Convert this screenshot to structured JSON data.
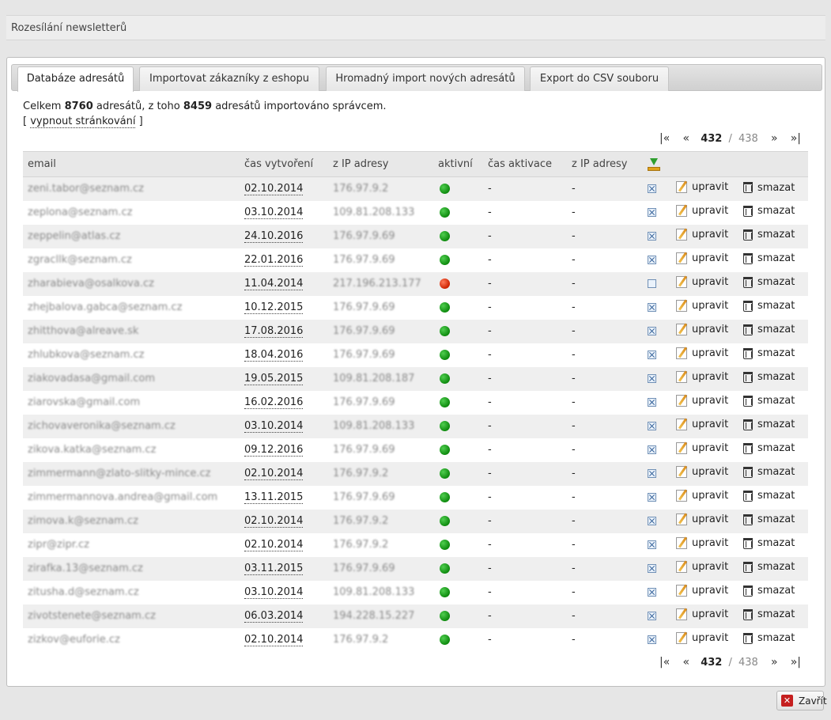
{
  "header": {
    "title": "Rozesílání newsletterů"
  },
  "tabs": [
    {
      "label": "Databáze adresátů",
      "active": true
    },
    {
      "label": "Importovat zákazníky z eshopu",
      "active": false
    },
    {
      "label": "Hromadný import nových adresátů",
      "active": false
    },
    {
      "label": "Export do CSV souboru",
      "active": false
    }
  ],
  "summary": {
    "prefix": "Celkem",
    "total": "8760",
    "middle": "adresátů, z toho",
    "imported": "8459",
    "suffix": "adresátů importováno správcem.",
    "paging_open": "[",
    "paging_link": "vypnout stránkování",
    "paging_close": "]"
  },
  "pager": {
    "first": "|«",
    "prev": "«",
    "current": "432",
    "separator": "/",
    "total": "438",
    "next": "»",
    "last": "»|"
  },
  "columns": {
    "email": "email",
    "created": "čas vytvoření",
    "ip": "z IP adresy",
    "active": "aktivní",
    "activated": "čas aktivace",
    "activated_ip": "z IP adresy",
    "export_icon": "export-icon"
  },
  "actions": {
    "edit": "upravit",
    "delete": "smazat"
  },
  "rows": [
    {
      "email": "zeni.tabor@seznam.cz",
      "created": "02.10.2014",
      "ip": "176.97.9.2",
      "active": true,
      "activated": "-",
      "activated_ip": "-",
      "checked": true
    },
    {
      "email": "zeplona@seznam.cz",
      "created": "03.10.2014",
      "ip": "109.81.208.133",
      "active": true,
      "activated": "-",
      "activated_ip": "-",
      "checked": true
    },
    {
      "email": "zeppelin@atlas.cz",
      "created": "24.10.2016",
      "ip": "176.97.9.69",
      "active": true,
      "activated": "-",
      "activated_ip": "-",
      "checked": true
    },
    {
      "email": "zgracllk@seznam.cz",
      "created": "22.01.2016",
      "ip": "176.97.9.69",
      "active": true,
      "activated": "-",
      "activated_ip": "-",
      "checked": true
    },
    {
      "email": "zharabieva@osalkova.cz",
      "created": "11.04.2014",
      "ip": "217.196.213.177",
      "active": false,
      "activated": "-",
      "activated_ip": "-",
      "checked": false
    },
    {
      "email": "zhejbalova.gabca@seznam.cz",
      "created": "10.12.2015",
      "ip": "176.97.9.69",
      "active": true,
      "activated": "-",
      "activated_ip": "-",
      "checked": true
    },
    {
      "email": "zhitthova@alreave.sk",
      "created": "17.08.2016",
      "ip": "176.97.9.69",
      "active": true,
      "activated": "-",
      "activated_ip": "-",
      "checked": true
    },
    {
      "email": "zhlubkova@seznam.cz",
      "created": "18.04.2016",
      "ip": "176.97.9.69",
      "active": true,
      "activated": "-",
      "activated_ip": "-",
      "checked": true
    },
    {
      "email": "ziakovadasa@gmail.com",
      "created": "19.05.2015",
      "ip": "109.81.208.187",
      "active": true,
      "activated": "-",
      "activated_ip": "-",
      "checked": true
    },
    {
      "email": "ziarovska@gmail.com",
      "created": "16.02.2016",
      "ip": "176.97.9.69",
      "active": true,
      "activated": "-",
      "activated_ip": "-",
      "checked": true
    },
    {
      "email": "zichovaveronika@seznam.cz",
      "created": "03.10.2014",
      "ip": "109.81.208.133",
      "active": true,
      "activated": "-",
      "activated_ip": "-",
      "checked": true
    },
    {
      "email": "zikova.katka@seznam.cz",
      "created": "09.12.2016",
      "ip": "176.97.9.69",
      "active": true,
      "activated": "-",
      "activated_ip": "-",
      "checked": true
    },
    {
      "email": "zimmermann@zlato-slitky-mince.cz",
      "created": "02.10.2014",
      "ip": "176.97.9.2",
      "active": true,
      "activated": "-",
      "activated_ip": "-",
      "checked": true
    },
    {
      "email": "zimmermannova.andrea@gmail.com",
      "created": "13.11.2015",
      "ip": "176.97.9.69",
      "active": true,
      "activated": "-",
      "activated_ip": "-",
      "checked": true
    },
    {
      "email": "zimova.k@seznam.cz",
      "created": "02.10.2014",
      "ip": "176.97.9.2",
      "active": true,
      "activated": "-",
      "activated_ip": "-",
      "checked": true
    },
    {
      "email": "zipr@zipr.cz",
      "created": "02.10.2014",
      "ip": "176.97.9.2",
      "active": true,
      "activated": "-",
      "activated_ip": "-",
      "checked": true
    },
    {
      "email": "zirafka.13@seznam.cz",
      "created": "03.11.2015",
      "ip": "176.97.9.69",
      "active": true,
      "activated": "-",
      "activated_ip": "-",
      "checked": true
    },
    {
      "email": "zitusha.d@seznam.cz",
      "created": "03.10.2014",
      "ip": "109.81.208.133",
      "active": true,
      "activated": "-",
      "activated_ip": "-",
      "checked": true
    },
    {
      "email": "zivotstenete@seznam.cz",
      "created": "06.03.2014",
      "ip": "194.228.15.227",
      "active": true,
      "activated": "-",
      "activated_ip": "-",
      "checked": true
    },
    {
      "email": "zizkov@euforie.cz",
      "created": "02.10.2014",
      "ip": "176.97.9.2",
      "active": true,
      "activated": "-",
      "activated_ip": "-",
      "checked": true
    }
  ],
  "close_button": {
    "label": "Zavřít"
  },
  "colors": {
    "active": "#1a9a1a",
    "inactive": "#d62b00",
    "header_bg": "#e8e8e8"
  }
}
